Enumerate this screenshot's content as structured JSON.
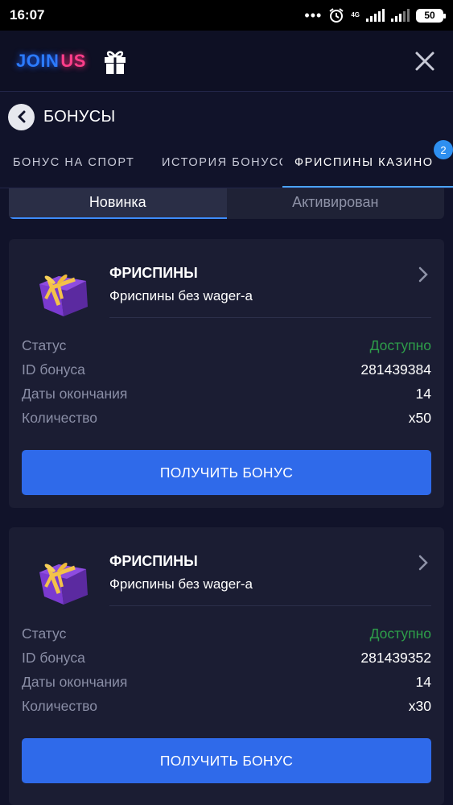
{
  "status_bar": {
    "time": "16:07",
    "network": "4G",
    "battery": "50"
  },
  "header": {
    "logo_join": "JOIN",
    "logo_us": "US"
  },
  "page": {
    "title": "БОНУСЫ"
  },
  "tabs": [
    {
      "label": "БОНУС НА СПОРТ"
    },
    {
      "label": "ИСТОРИЯ БОНУСОВ"
    },
    {
      "label": "ФРИСПИНЫ КАЗИНО",
      "badge": "2",
      "active": true
    }
  ],
  "segments": [
    {
      "label": "Новинка",
      "active": true
    },
    {
      "label": "Активирован"
    }
  ],
  "colors": {
    "accent": "#2f6aea",
    "status_ok": "#2e9f4a",
    "tab_underline": "#4aa3ff",
    "badge": "#2e8ff0"
  },
  "bonuses": [
    {
      "title": "ФРИСПИНЫ",
      "subtitle": "Фриспины без wager-а",
      "rows": [
        {
          "label": "Статус",
          "value": "Доступно"
        },
        {
          "label": "ID бонуса",
          "value": "281439384"
        },
        {
          "label": "Даты окончания",
          "value": "14"
        },
        {
          "label": "Количество",
          "value": "x50"
        }
      ],
      "button": "ПОЛУЧИТЬ БОНУС"
    },
    {
      "title": "ФРИСПИНЫ",
      "subtitle": "Фриспины без wager-а",
      "rows": [
        {
          "label": "Статус",
          "value": "Доступно"
        },
        {
          "label": "ID бонуса",
          "value": "281439352"
        },
        {
          "label": "Даты окончания",
          "value": "14"
        },
        {
          "label": "Количество",
          "value": "x30"
        }
      ],
      "button": "ПОЛУЧИТЬ БОНУС"
    }
  ],
  "icons": [
    "alarm-icon",
    "gift-icon",
    "close-icon",
    "back-arrow-icon",
    "chevron-right-icon",
    "present-box-icon"
  ]
}
